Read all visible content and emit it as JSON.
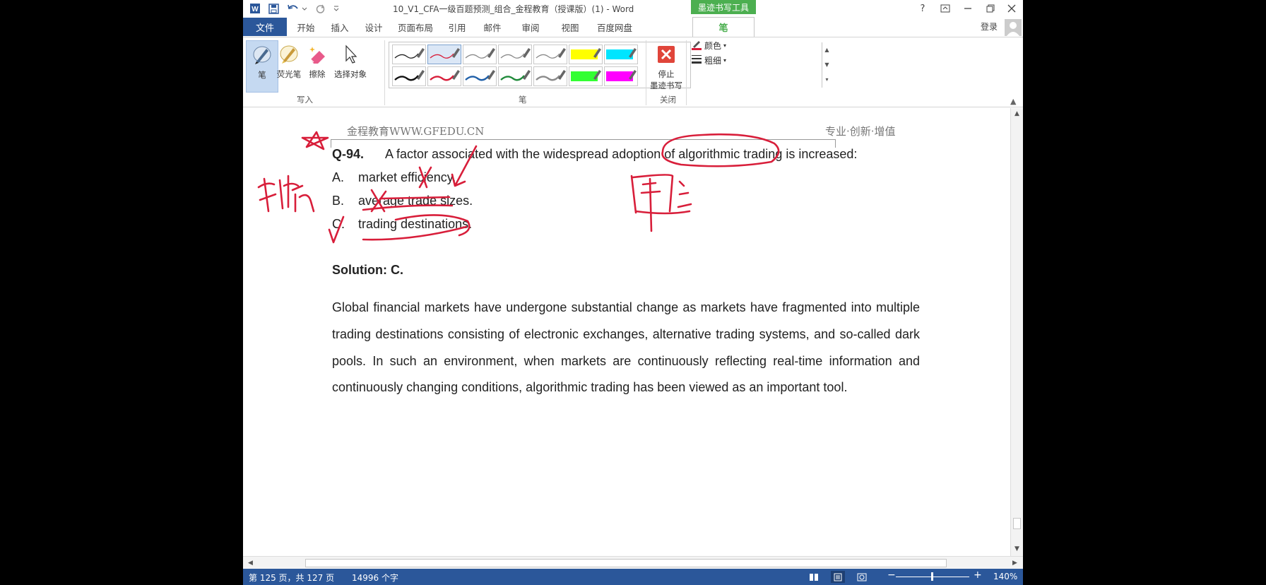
{
  "window": {
    "title": "10_V1_CFA一级百题预测_组合_金程教育（授课版）(1) - Word",
    "context_tool_label": "墨迹书写工具",
    "help_label": "?",
    "login_label": "登录"
  },
  "tabs": {
    "file": "文件",
    "items": [
      "开始",
      "插入",
      "设计",
      "页面布局",
      "引用",
      "邮件",
      "审阅",
      "视图",
      "百度网盘"
    ],
    "active": "笔"
  },
  "ribbon": {
    "write_group": {
      "tools": [
        "笔",
        "荧光笔",
        "擦除",
        "选择对象"
      ],
      "label": "写入"
    },
    "pen_group": {
      "label": "笔",
      "color_label": "颜色",
      "thickness_label": "粗细",
      "swatch_colors_row1": [
        "#222222",
        "#d81e3a",
        "#8a8a8a",
        "#8a8a8a",
        "#8a8a8a",
        "#ffff00",
        "#00e5ff"
      ],
      "swatch_colors_row2": [
        "#111111",
        "#d81e3a",
        "#1f5fa8",
        "#1f8a3a",
        "#8a8a8a",
        "#33ff33",
        "#ff00ff"
      ]
    },
    "close_group": {
      "stop_line1": "停止",
      "stop_line2": "墨迹书写",
      "label": "关闭"
    }
  },
  "document": {
    "header_left": "金程教育WWW.GFEDU.CN",
    "header_right": "专业·创新·增值",
    "question": {
      "number": "Q-94.",
      "stem": "A factor associated with the widespread adoption of algorithmic trading is increased:",
      "options": [
        {
          "letter": "A.",
          "text": "market efficiency."
        },
        {
          "letter": "B.",
          "text": "average trade sizes."
        },
        {
          "letter": "C.",
          "text": "trading destinations."
        }
      ]
    },
    "solution": {
      "title": "Solution: C.",
      "body": "Global financial markets have undergone substantial change as markets have fragmented into multiple trading destinations consisting of electronic exchanges, alternative trading systems, and so-called dark pools. In such an environment, when markets are continuously reflecting real-time information and continuously changing conditions, algorithmic trading has been viewed as an important tool."
    },
    "ink_color": "#d81e3a"
  },
  "statusbar": {
    "page": "第 125 页，共 127 页",
    "words": "14996 个字",
    "zoom": "140%",
    "zoom_minus": "−",
    "zoom_plus": "+"
  }
}
